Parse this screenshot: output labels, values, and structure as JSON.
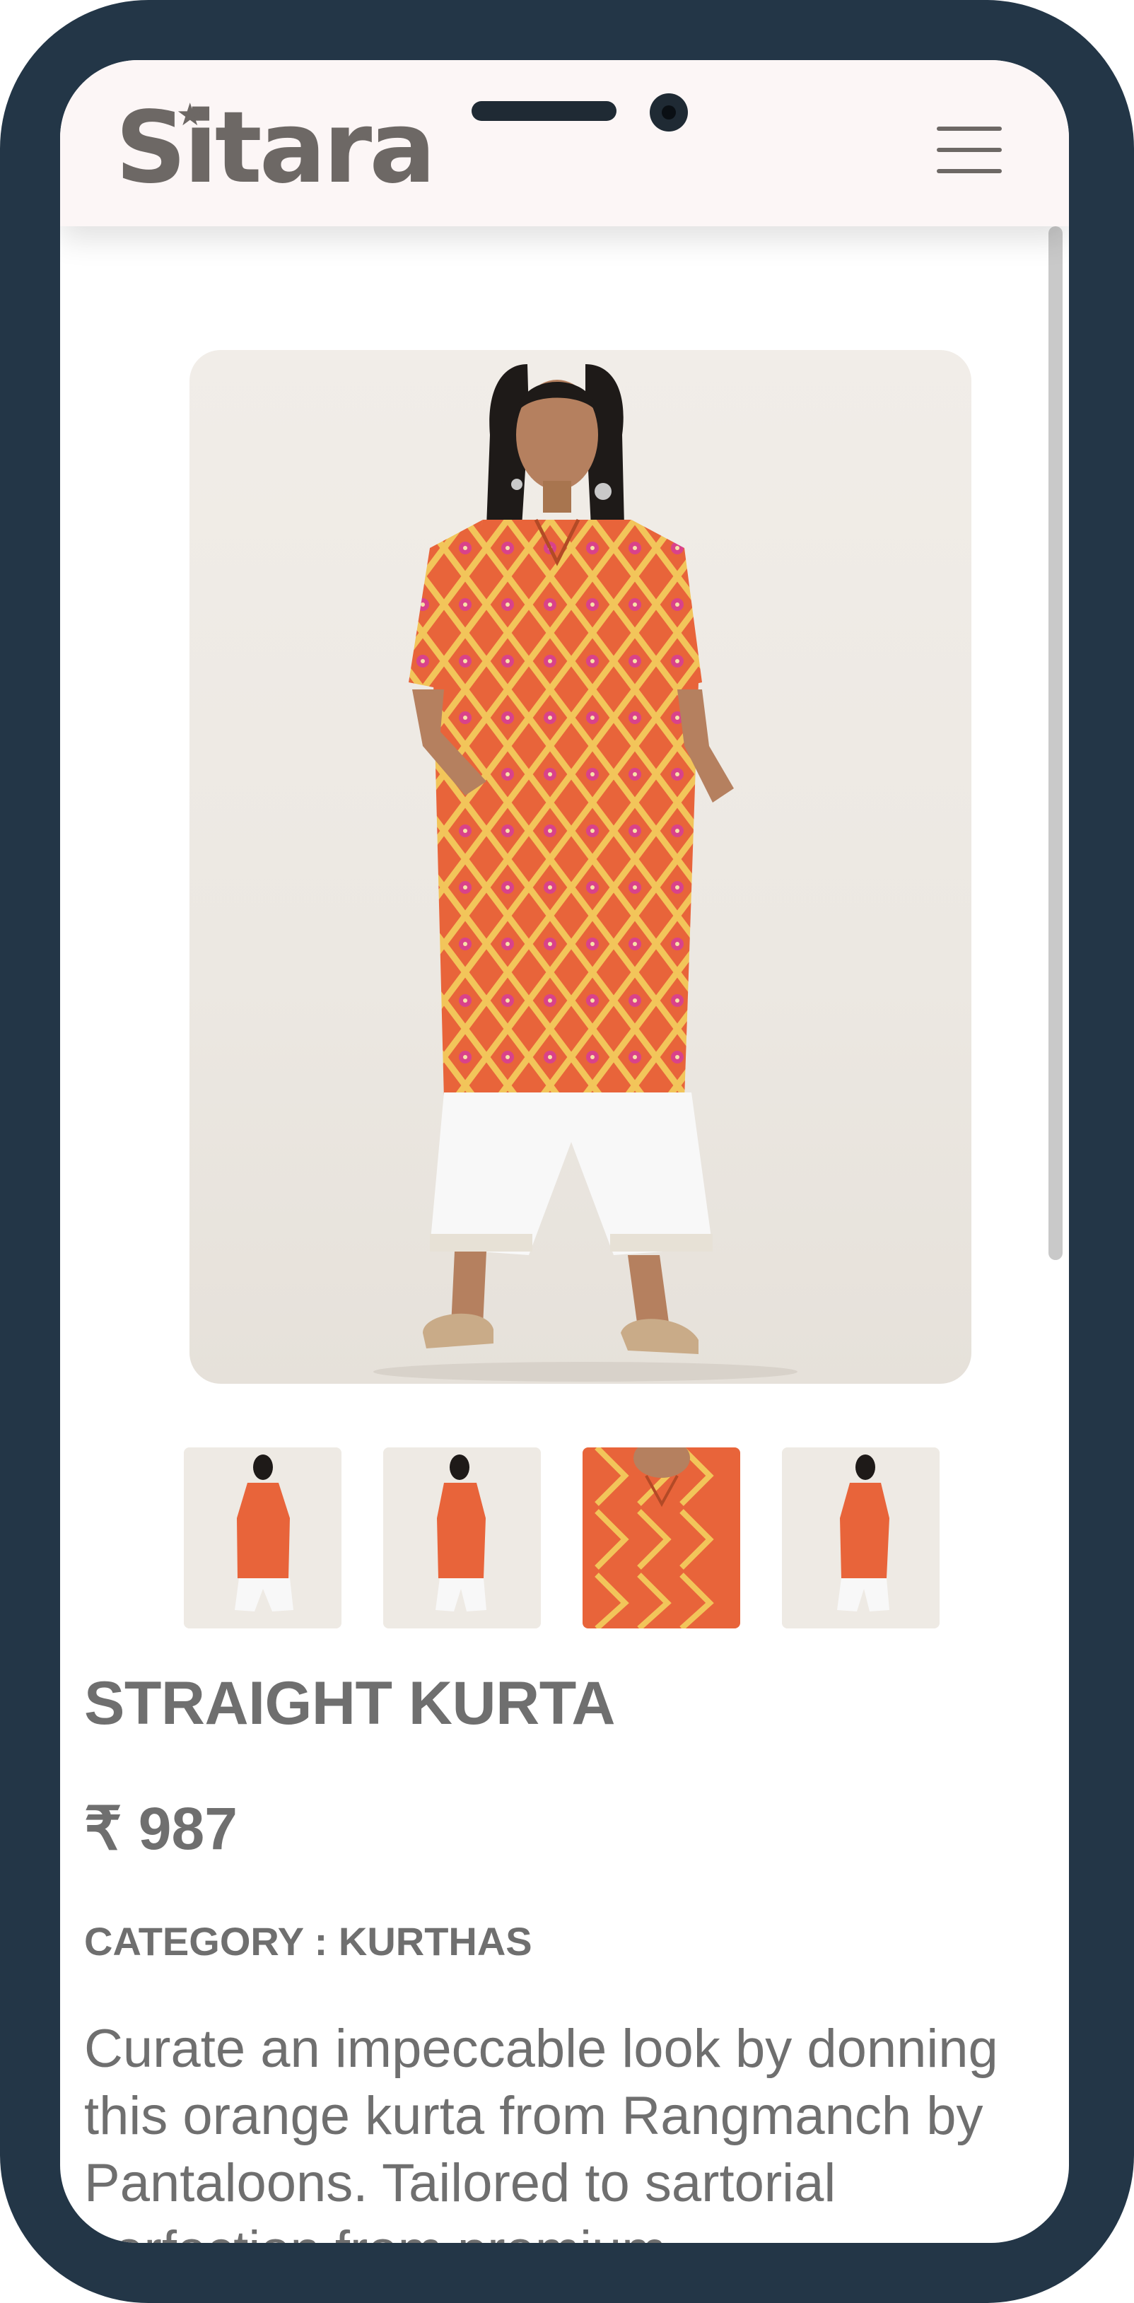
{
  "header": {
    "logo_text": "Sitara",
    "menu_icon": "hamburger-menu-icon"
  },
  "product": {
    "title": "STRAIGHT KURTA",
    "price": "₹ 987",
    "category": "CATEGORY : KURTHAS",
    "description": "Curate an impeccable look by donning this orange kurta from Rangmanch by Pantaloons. Tailored to sartorial perfection from premium"
  },
  "gallery": {
    "thumbnail_count": 4
  },
  "colors": {
    "device_frame": "#233647",
    "header_bg": "#fcf6f6",
    "logo": "#6d6865",
    "text": "#6f6f6f",
    "kurta": "#e8643a",
    "kurta_pattern": "#f2c55a"
  }
}
